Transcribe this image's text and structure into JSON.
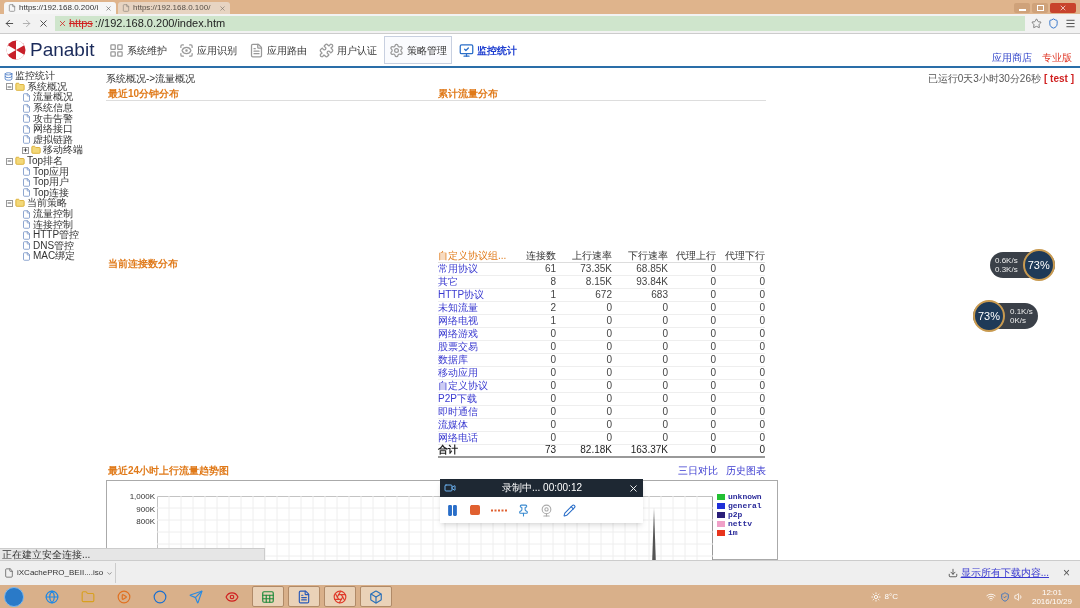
{
  "browser": {
    "tabs": [
      {
        "title": "https://192.168.0.200/i",
        "selected": true
      },
      {
        "title": "https://192.168.0.100/",
        "selected": false
      }
    ],
    "url_scheme": "https",
    "url_rest": "://192.168.0.200/index.htm"
  },
  "header": {
    "logo": "Panabit",
    "nav": [
      {
        "label": "系统维护",
        "selected": false,
        "hovered": false
      },
      {
        "label": "应用识别",
        "selected": false,
        "hovered": false
      },
      {
        "label": "应用路由",
        "selected": false,
        "hovered": false
      },
      {
        "label": "用户认证",
        "selected": false,
        "hovered": false
      },
      {
        "label": "策略管理",
        "selected": false,
        "hovered": true
      },
      {
        "label": "监控统计",
        "selected": true,
        "hovered": false
      }
    ],
    "links": [
      {
        "label": "应用商店",
        "kind": "store"
      },
      {
        "label": "专业版",
        "kind": "edition"
      }
    ]
  },
  "sidebar": {
    "tree": [
      {
        "label": "监控统计",
        "kind": "root",
        "children": [
          {
            "label": "系统概况",
            "kind": "folder",
            "expanded": true,
            "children": [
              {
                "label": "流量概况",
                "kind": "page"
              },
              {
                "label": "系统信息",
                "kind": "page"
              },
              {
                "label": "攻击告警",
                "kind": "page"
              },
              {
                "label": "网络接口",
                "kind": "page"
              },
              {
                "label": "虚拟链路",
                "kind": "page"
              },
              {
                "label": "移动终端",
                "kind": "folder",
                "expanded": false
              }
            ]
          },
          {
            "label": "Top排名",
            "kind": "folder",
            "expanded": true,
            "children": [
              {
                "label": "Top应用",
                "kind": "page"
              },
              {
                "label": "Top用户",
                "kind": "page"
              },
              {
                "label": "Top连接",
                "kind": "page"
              }
            ]
          },
          {
            "label": "当前策略",
            "kind": "folder",
            "expanded": true,
            "children": [
              {
                "label": "流量控制",
                "kind": "page"
              },
              {
                "label": "连接控制",
                "kind": "page"
              },
              {
                "label": "HTTP管控",
                "kind": "page"
              },
              {
                "label": "DNS管控",
                "kind": "page"
              },
              {
                "label": "MAC绑定",
                "kind": "page"
              }
            ]
          }
        ]
      }
    ]
  },
  "main": {
    "breadcrumb": "系统概况->流量概况",
    "uptime": "已运行0天3小时30分26秒",
    "user": "[ test ]",
    "panels": [
      "最近10分钟分布",
      "累计流量分布"
    ],
    "connections_title": "当前连接数分布",
    "table": {
      "columns": [
        "自定义协议组...",
        "连接数",
        "上行速率",
        "下行速率",
        "代理上行",
        "代理下行"
      ],
      "rows": [
        [
          "常用协议",
          "61",
          "73.35K",
          "68.85K",
          "0",
          "0"
        ],
        [
          "其它",
          "8",
          "8.15K",
          "93.84K",
          "0",
          "0"
        ],
        [
          "HTTP协议",
          "1",
          "672",
          "683",
          "0",
          "0"
        ],
        [
          "未知流量",
          "2",
          "0",
          "0",
          "0",
          "0"
        ],
        [
          "网络电视",
          "1",
          "0",
          "0",
          "0",
          "0"
        ],
        [
          "网络游戏",
          "0",
          "0",
          "0",
          "0",
          "0"
        ],
        [
          "股票交易",
          "0",
          "0",
          "0",
          "0",
          "0"
        ],
        [
          "数据库",
          "0",
          "0",
          "0",
          "0",
          "0"
        ],
        [
          "移动应用",
          "0",
          "0",
          "0",
          "0",
          "0"
        ],
        [
          "自定义协议",
          "0",
          "0",
          "0",
          "0",
          "0"
        ],
        [
          "P2P下载",
          "0",
          "0",
          "0",
          "0",
          "0"
        ],
        [
          "即时通信",
          "0",
          "0",
          "0",
          "0",
          "0"
        ],
        [
          "流媒体",
          "0",
          "0",
          "0",
          "0",
          "0"
        ],
        [
          "网络电话",
          "0",
          "0",
          "0",
          "0",
          "0"
        ]
      ],
      "total": [
        "合计",
        "73",
        "82.18K",
        "163.37K",
        "0",
        "0"
      ]
    },
    "trend": {
      "title": "最近24小时上行流量趋势图",
      "links": [
        "三日对比",
        "历史图表"
      ],
      "yticks": [
        "1,000K",
        "900K",
        "800K"
      ],
      "legend": [
        {
          "label": "unknown",
          "color": "#22c033"
        },
        {
          "label": "general",
          "color": "#1f2fd8"
        },
        {
          "label": "p2p",
          "color": "#2a1e78"
        },
        {
          "label": "nettv",
          "color": "#f0a0c8"
        },
        {
          "label": "im",
          "color": "#e8341c"
        }
      ]
    }
  },
  "recorder": {
    "title": "录制中... 00:00:12"
  },
  "net_widgets": [
    {
      "percent": "73%",
      "up": "0.6K/s",
      "down": "0.3K/s"
    },
    {
      "percent": "73%",
      "up": "0.1K/s",
      "down": "0K/s"
    }
  ],
  "status": "正在建立安全连接...",
  "downloads": {
    "file": "iXCachePRO_BEII....iso",
    "show_all": "显示所有下载内容...",
    "close": "×"
  },
  "taskbar": {
    "apps": [
      {
        "kind": "browser",
        "running": false
      },
      {
        "kind": "folder",
        "running": false
      },
      {
        "kind": "player",
        "running": false
      },
      {
        "kind": "circle",
        "running": false
      },
      {
        "kind": "plane",
        "running": false
      },
      {
        "kind": "eye",
        "running": false
      },
      {
        "kind": "sheet",
        "running": true
      },
      {
        "kind": "doc",
        "running": true
      },
      {
        "kind": "aperture",
        "running": true
      },
      {
        "kind": "box",
        "running": true
      }
    ],
    "temperature": "8°C",
    "time": "12:01",
    "date": "2016/10/29"
  }
}
